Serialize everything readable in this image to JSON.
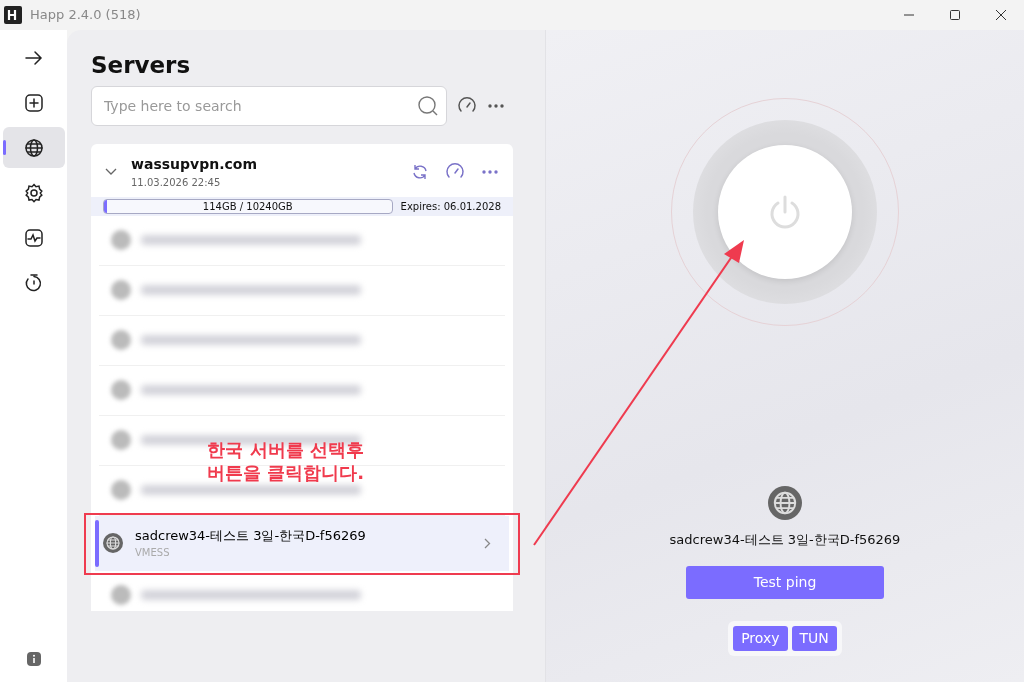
{
  "window": {
    "title": "Happ 2.4.0 (518)"
  },
  "sidebar": {
    "items": [
      {
        "kind": "arrow",
        "selected": false
      },
      {
        "kind": "add",
        "selected": false
      },
      {
        "kind": "globe",
        "selected": true
      },
      {
        "kind": "settings",
        "selected": false
      },
      {
        "kind": "stats",
        "selected": false
      },
      {
        "kind": "timer",
        "selected": false
      }
    ]
  },
  "servers": {
    "title": "Servers",
    "search": {
      "placeholder": "Type here to search"
    },
    "subscription": {
      "name": "wassupvpn.com",
      "updated": "11.03.2026 22:45",
      "usage": "114GB / 10240GB",
      "level": 0.011,
      "expires": "Expires: 06.01.2028",
      "expanded": true
    },
    "rows": [
      {
        "kind": "blurred"
      },
      {
        "kind": "blurred"
      },
      {
        "kind": "blurred"
      },
      {
        "kind": "blurred"
      },
      {
        "kind": "blurred"
      },
      {
        "kind": "blurred"
      },
      {
        "kind": "server",
        "name": "sadcrew34-테스트 3일-한국D-f56269",
        "protocol": "VMESS",
        "selected": true
      },
      {
        "kind": "blurred"
      }
    ]
  },
  "connection": {
    "server_name": "sadcrew34-테스트 3일-한국D-f56269",
    "test_button": "Test ping",
    "modes": [
      {
        "label": "Proxy",
        "selected": true
      },
      {
        "label": "TUN",
        "selected": true
      }
    ]
  },
  "annotation": {
    "text": "한국 서버를 선택후\n버튼을 클릭합니다."
  }
}
